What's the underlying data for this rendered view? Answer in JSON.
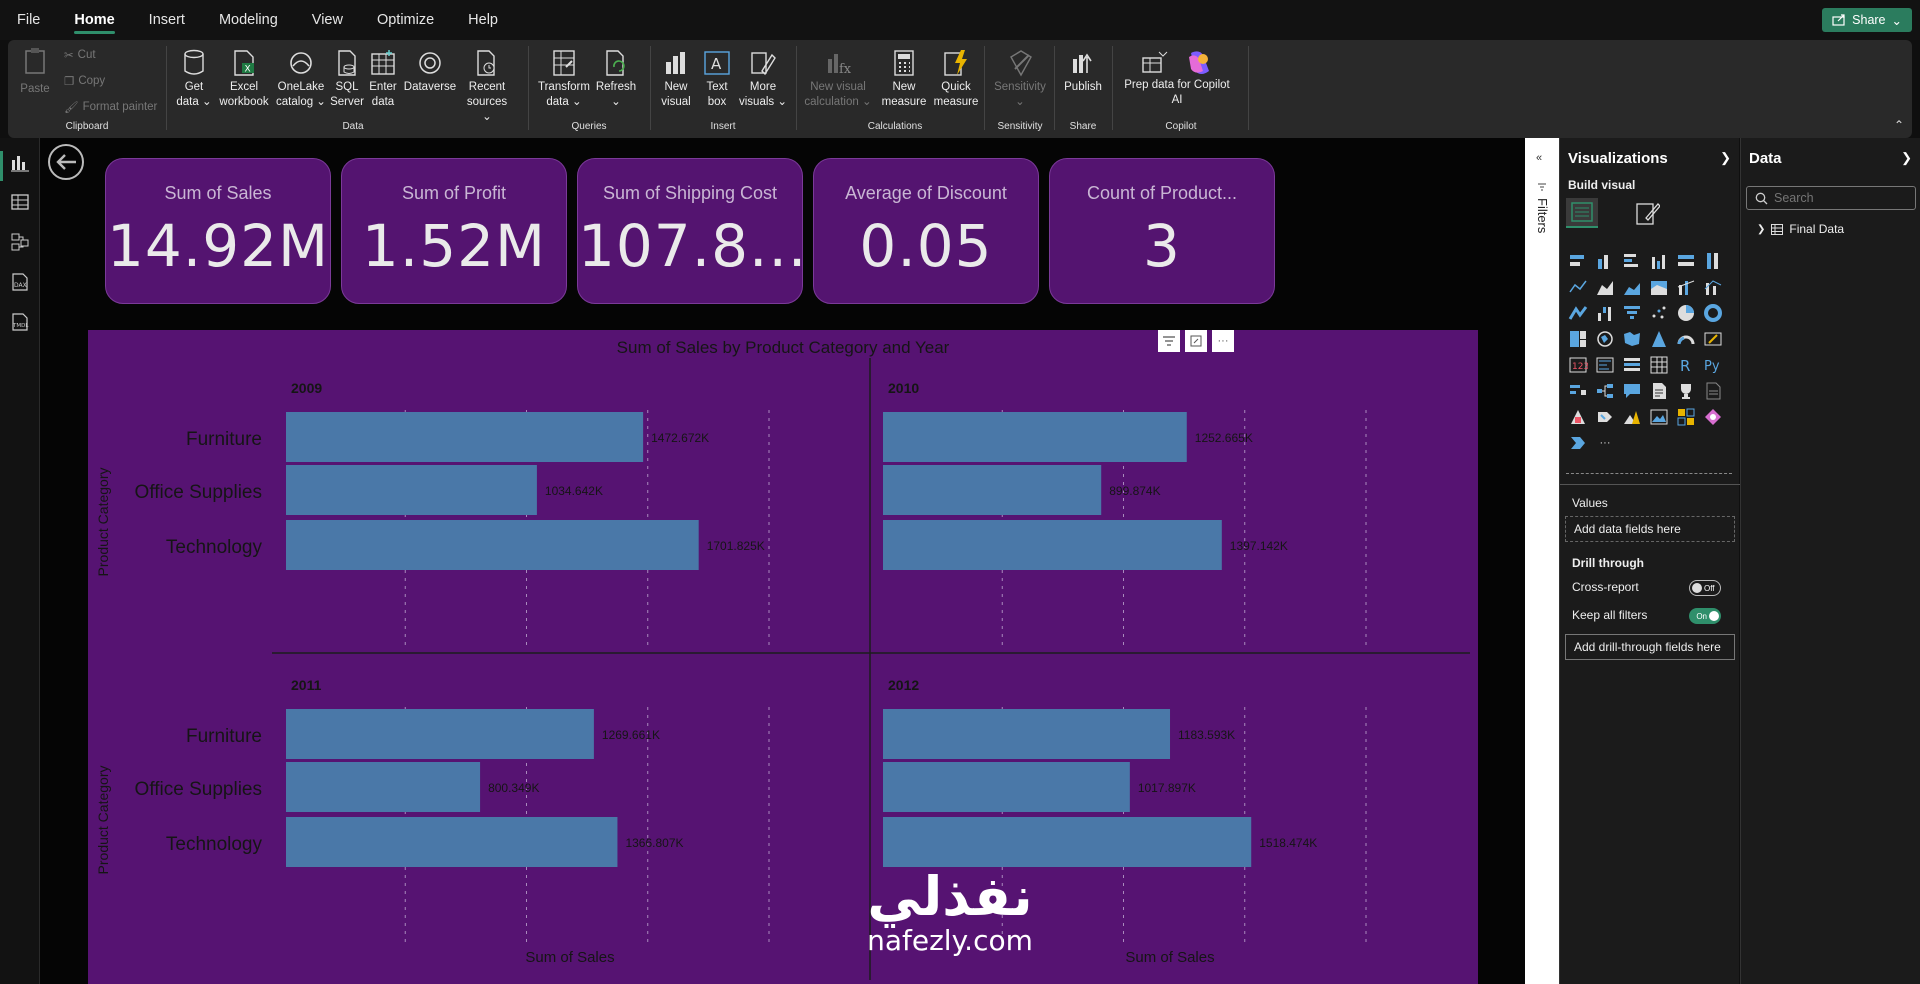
{
  "menu": {
    "items": [
      "File",
      "Home",
      "Insert",
      "Modeling",
      "View",
      "Optimize",
      "Help"
    ],
    "active": "Home",
    "share_label": "Share"
  },
  "ribbon": {
    "clipboard": {
      "paste": "Paste",
      "cut": "Cut",
      "copy": "Copy",
      "format_painter": "Format painter",
      "label": "Clipboard"
    },
    "data": {
      "label": "Data",
      "buttons": [
        {
          "line1": "Get",
          "line2": "data ⌄"
        },
        {
          "line1": "Excel",
          "line2": "workbook"
        },
        {
          "line1": "OneLake",
          "line2": "catalog ⌄"
        },
        {
          "line1": "SQL",
          "line2": "Server"
        },
        {
          "line1": "Enter",
          "line2": "data"
        },
        {
          "line1": "Dataverse",
          "line2": ""
        },
        {
          "line1": "Recent",
          "line2": "sources ⌄"
        }
      ]
    },
    "queries": {
      "label": "Queries",
      "transform_1": "Transform",
      "transform_2": "data ⌄",
      "refresh_1": "Refresh",
      "refresh_2": "⌄"
    },
    "insert": {
      "label": "Insert",
      "new_visual_1": "New",
      "new_visual_2": "visual",
      "text_box_1": "Text",
      "text_box_2": "box",
      "more_visuals_1": "More",
      "more_visuals_2": "visuals ⌄"
    },
    "calculations": {
      "label": "Calculations",
      "new_visual_calc_1": "New visual",
      "new_visual_calc_2": "calculation ⌄",
      "new_measure_1": "New",
      "new_measure_2": "measure",
      "quick_measure_1": "Quick",
      "quick_measure_2": "measure"
    },
    "sensitivity": {
      "label": "Sensitivity",
      "btn_1": "Sensitivity",
      "btn_2": "⌄"
    },
    "share": {
      "label": "Share",
      "publish": "Publish"
    },
    "copilot": {
      "label": "Copilot",
      "btn_1": "Prep data for Copilot",
      "btn_2": "AI"
    }
  },
  "cards": [
    {
      "title": "Sum of Sales",
      "value": "14.92M"
    },
    {
      "title": "Sum of Profit",
      "value": "1.52M"
    },
    {
      "title": "Sum of Shipping Cost",
      "value": "107.8..."
    },
    {
      "title": "Average of Discount",
      "value": "0.05"
    },
    {
      "title": "Count of Product...",
      "value": "3"
    }
  ],
  "chart_data": {
    "type": "bar",
    "title": "Sum of Sales by Product Category and Year",
    "xlabel": "Sum of Sales",
    "ylabel": "Product Category",
    "categories": [
      "Furniture",
      "Office Supplies",
      "Technology"
    ],
    "xlim": [
      0,
      2000
    ],
    "bar_color": "#4a78a8",
    "panels": [
      {
        "year": "2009",
        "values": [
          1472.672,
          1034.642,
          1701.825
        ],
        "labels": [
          "1472.672K",
          "1034.642K",
          "1701.825K"
        ]
      },
      {
        "year": "2010",
        "values": [
          1252.665,
          899.874,
          1397.142
        ],
        "labels": [
          "1252.665K",
          "899.874K",
          "1397.142K"
        ]
      },
      {
        "year": "2011",
        "values": [
          1269.661,
          800.349,
          1366.807
        ],
        "labels": [
          "1269.661K",
          "800.349K",
          "1366.807K"
        ]
      },
      {
        "year": "2012",
        "values": [
          1183.593,
          1017.897,
          1518.474
        ],
        "labels": [
          "1183.593K",
          "1017.897K",
          "1518.474K"
        ]
      }
    ]
  },
  "filters": {
    "label": "Filters"
  },
  "visualizations": {
    "title": "Visualizations",
    "build_visual": "Build visual",
    "values_label": "Values",
    "values_placeholder": "Add data fields here",
    "drill_through": "Drill through",
    "cross_report": "Cross-report",
    "cross_report_state": "Off",
    "keep_filters": "Keep all filters",
    "keep_filters_state": "On",
    "drill_placeholder": "Add drill-through fields here",
    "more": "···",
    "r_label": "R",
    "py_label": "Py"
  },
  "data_pane": {
    "title": "Data",
    "search_placeholder": "Search",
    "table": "Final Data"
  },
  "watermark": {
    "arabic": "نفذلي",
    "latin": "nafezly.com"
  },
  "colors": {
    "card_bg": "#541470",
    "chart_bg": "#561372",
    "accent": "#2f8f6b"
  }
}
